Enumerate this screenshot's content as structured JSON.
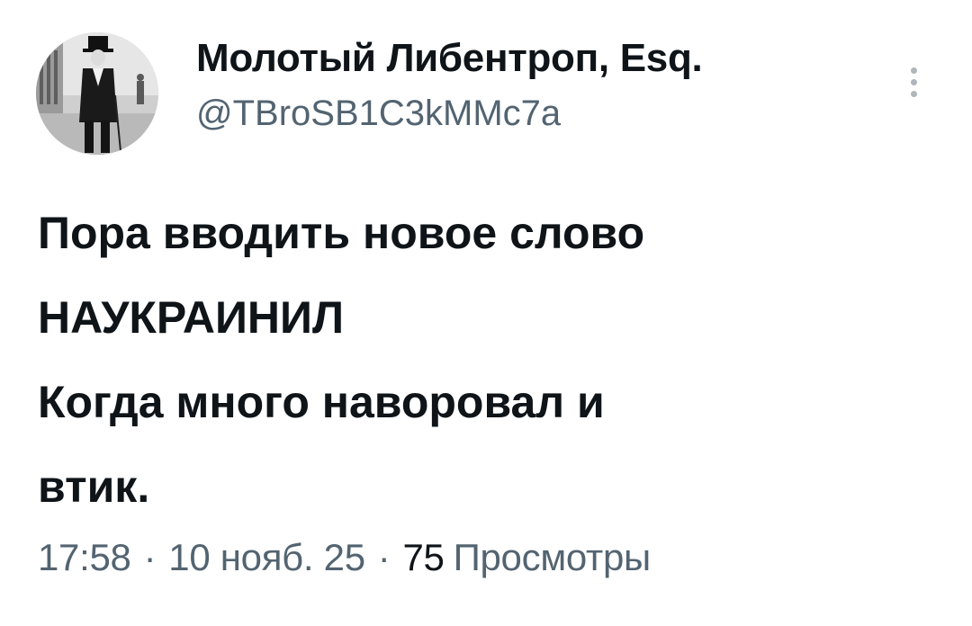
{
  "tweet": {
    "author": {
      "display_name": "Молотый Либентроп, Esq.",
      "handle": "@TBroSB1C3kMMc7a"
    },
    "text_lines": [
      "Пора вводить новое слово",
      "НАУКРАИНИЛ",
      "Когда много наворовал и",
      "втик."
    ],
    "meta": {
      "time": "17:58",
      "separator": "·",
      "date": "10 нояб. 25",
      "views_count": "75",
      "views_label": "Просмотры"
    },
    "icons": {
      "avatar": "avatar-photo",
      "more": "more-vertical-icon"
    }
  }
}
